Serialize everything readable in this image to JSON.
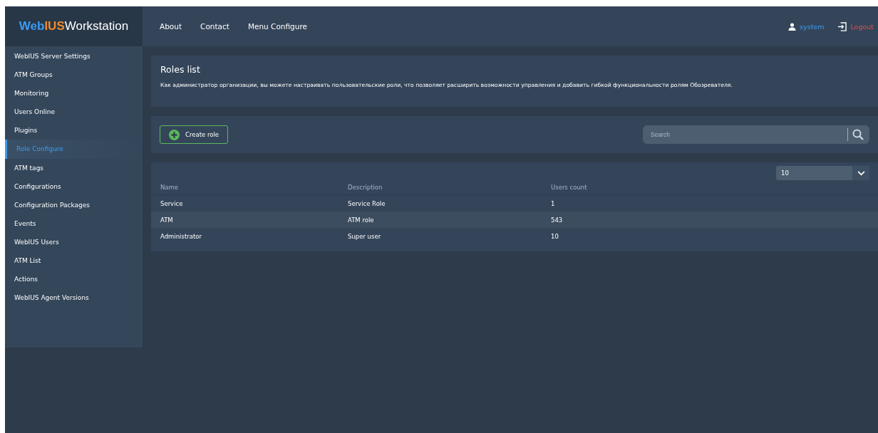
{
  "logo": [
    "Web",
    "IUS",
    "Workstation"
  ],
  "nav": [
    "About",
    "Contact",
    "Menu Configure"
  ],
  "user": {
    "name": "system",
    "logout": "Logout"
  },
  "sidebar": {
    "items": [
      {
        "label": "WebIUS Server Settings",
        "selected": false
      },
      {
        "label": "ATM Groups",
        "selected": false
      },
      {
        "label": "Monitoring",
        "selected": false
      },
      {
        "label": "Users Online",
        "selected": false
      },
      {
        "label": "Plugins",
        "selected": false
      },
      {
        "label": "Role Configure",
        "selected": true
      },
      {
        "label": "ATM tags",
        "selected": false
      },
      {
        "label": "Configurations",
        "selected": false
      },
      {
        "label": "Configuration Packages",
        "selected": false
      },
      {
        "label": "Events",
        "selected": false
      },
      {
        "label": "WebIUS Users",
        "selected": false
      },
      {
        "label": "ATM List",
        "selected": false
      },
      {
        "label": "Actions",
        "selected": false
      },
      {
        "label": "WebIUS Agent Versions",
        "selected": false
      }
    ]
  },
  "intro": {
    "title": "Roles list",
    "text": "Как администратор организации, вы можете настраивать пользовательские роли, что позволяет расширить возможности управления и добавить гибкой функциональности ролям Обозревателя."
  },
  "toolbar": {
    "create_button": "Create role",
    "search": {
      "placeholder": "Search"
    }
  },
  "table": {
    "page_size": "10",
    "columns": [
      "Name",
      "Description",
      "Users count"
    ],
    "rows": [
      [
        "Service",
        "Service Role",
        "1"
      ],
      [
        "ATM",
        "ATM role",
        "543"
      ],
      [
        "Administrator",
        "Super user",
        "10"
      ]
    ]
  }
}
